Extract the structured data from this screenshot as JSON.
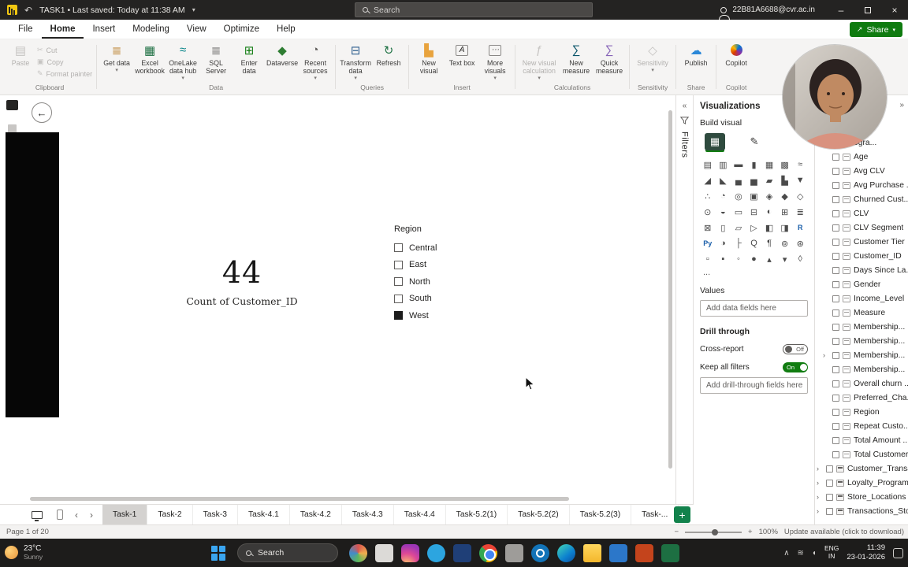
{
  "titlebar": {
    "document_title": "TASK1 • Last saved: Today at 11:38 AM",
    "search_placeholder": "Search",
    "account_email": "22B81A6688@cvr.ac.in"
  },
  "menubar": {
    "items": [
      "File",
      "Home",
      "Insert",
      "Modeling",
      "View",
      "Optimize",
      "Help"
    ],
    "share_label": "Share"
  },
  "ribbon": {
    "clipboard": {
      "label": "Clipboard",
      "paste": "Paste",
      "cut": "Cut",
      "copy": "Copy",
      "format_painter": "Format painter"
    },
    "data": {
      "label": "Data",
      "get_data": "Get data",
      "excel_workbook": "Excel workbook",
      "onelake": "OneLake data hub",
      "sql_server": "SQL Server",
      "enter_data": "Enter data",
      "dataverse": "Dataverse",
      "recent_sources": "Recent sources"
    },
    "queries": {
      "label": "Queries",
      "transform_data": "Transform data",
      "refresh": "Refresh"
    },
    "insert_group": {
      "label": "Insert",
      "new_visual": "New visual",
      "text_box": "Text box",
      "more_visuals": "More visuals"
    },
    "calculations": {
      "label": "Calculations",
      "new_visual_calculation": "New visual calculation",
      "new_measure": "New measure",
      "quick_measure": "Quick measure"
    },
    "sensitivity": {
      "label": "Sensitivity",
      "button": "Sensitivity"
    },
    "share": {
      "label": "Share",
      "publish": "Publish"
    },
    "copilot": {
      "label": "Copilot",
      "button": "Copilot"
    }
  },
  "canvas": {
    "card": {
      "value": "44",
      "label": "Count of Customer_ID"
    },
    "slicer": {
      "title": "Region",
      "options": [
        {
          "label": "Central",
          "checked": false
        },
        {
          "label": "East",
          "checked": false
        },
        {
          "label": "North",
          "checked": false
        },
        {
          "label": "South",
          "checked": false
        },
        {
          "label": "West",
          "checked": true
        }
      ]
    }
  },
  "filters_panel": {
    "label": "Filters"
  },
  "visualizations": {
    "title": "Visualizations",
    "build_visual_label": "Build visual",
    "more_icons_label": "...",
    "values_label": "Values",
    "values_placeholder": "Add data fields here",
    "drill_through_label": "Drill through",
    "cross_report_label": "Cross-report",
    "cross_report_state": "Off",
    "keep_all_filters_label": "Keep all filters",
    "keep_all_filters_state": "On",
    "drill_placeholder": "Add drill-through fields here",
    "accent_green": "#107c10",
    "icons": [
      {
        "name": "stacked-bar-chart",
        "glyph": "▤"
      },
      {
        "name": "stacked-column-chart",
        "glyph": "▥"
      },
      {
        "name": "clustered-bar-chart",
        "glyph": "▬"
      },
      {
        "name": "clustered-column-chart",
        "glyph": "▮"
      },
      {
        "name": "100-stacked-bar-chart",
        "glyph": "▦"
      },
      {
        "name": "100-stacked-column-chart",
        "glyph": "▩"
      },
      {
        "name": "line-chart",
        "glyph": "≈"
      },
      {
        "name": "area-chart",
        "glyph": "◢"
      },
      {
        "name": "stacked-area-chart",
        "glyph": "◣"
      },
      {
        "name": "line-and-stacked-column-chart",
        "glyph": "▄"
      },
      {
        "name": "line-and-clustered-column-chart",
        "glyph": "▅"
      },
      {
        "name": "ribbon-chart",
        "glyph": "▰"
      },
      {
        "name": "waterfall-chart",
        "glyph": "▙"
      },
      {
        "name": "funnel-chart",
        "glyph": "▼"
      },
      {
        "name": "scatter-chart",
        "glyph": "∴"
      },
      {
        "name": "pie-chart",
        "glyph": "◔"
      },
      {
        "name": "donut-chart",
        "glyph": "◎"
      },
      {
        "name": "treemap",
        "glyph": "▣"
      },
      {
        "name": "map",
        "glyph": "◈"
      },
      {
        "name": "filled-map",
        "glyph": "◆"
      },
      {
        "name": "shape-map",
        "glyph": "◇"
      },
      {
        "name": "azure-map",
        "glyph": "⊙"
      },
      {
        "name": "gauge",
        "glyph": "◒"
      },
      {
        "name": "card",
        "glyph": "▭"
      },
      {
        "name": "multi-row-card",
        "glyph": "⊟"
      },
      {
        "name": "kpi",
        "glyph": "◐"
      },
      {
        "name": "slicer",
        "glyph": "⊞"
      },
      {
        "name": "table",
        "glyph": "≣"
      },
      {
        "name": "matrix",
        "glyph": "⊠"
      },
      {
        "name": "paginated-report",
        "glyph": "▯"
      },
      {
        "name": "power-apps",
        "glyph": "▱"
      },
      {
        "name": "power-automate",
        "glyph": "▷"
      },
      {
        "name": "metrics",
        "glyph": "◧"
      },
      {
        "name": "scorecard",
        "glyph": "◨"
      },
      {
        "name": "r-script-visual",
        "glyph": "R"
      },
      {
        "name": "python-visual",
        "glyph": "Py"
      },
      {
        "name": "key-influencers",
        "glyph": "◑"
      },
      {
        "name": "decomposition-tree",
        "glyph": "├"
      },
      {
        "name": "qa-visual",
        "glyph": "Q"
      },
      {
        "name": "smart-narrative",
        "glyph": "¶"
      },
      {
        "name": "arcgis-map",
        "glyph": "⊚"
      },
      {
        "name": "power-bi-custom-visual",
        "glyph": "⊛"
      },
      {
        "name": "custom-visual-1",
        "glyph": "▫"
      },
      {
        "name": "custom-visual-2",
        "glyph": "▪"
      },
      {
        "name": "custom-visual-3",
        "glyph": "◦"
      },
      {
        "name": "custom-visual-4",
        "glyph": "●"
      },
      {
        "name": "custom-visual-5",
        "glyph": "▴"
      },
      {
        "name": "custom-visual-6",
        "glyph": "▾"
      },
      {
        "name": "custom-visual-7",
        "glyph": "◊"
      }
    ]
  },
  "fields": {
    "items": [
      {
        "label": "ogra...",
        "partial": true
      },
      {
        "label": "Age"
      },
      {
        "label": "Avg CLV"
      },
      {
        "label": "Avg Purchase ..."
      },
      {
        "label": "Churned Cust..."
      },
      {
        "label": "CLV"
      },
      {
        "label": "CLV Segment"
      },
      {
        "label": "Customer Tier"
      },
      {
        "label": "Customer_ID"
      },
      {
        "label": "Days Since La..."
      },
      {
        "label": "Gender"
      },
      {
        "label": "Income_Level"
      },
      {
        "label": "Measure"
      },
      {
        "label": "Membership..."
      },
      {
        "label": "Membership..."
      },
      {
        "label": "Membership...",
        "expander": true
      },
      {
        "label": "Membership..."
      },
      {
        "label": "Overall churn ..."
      },
      {
        "label": "Preferred_Cha..."
      },
      {
        "label": "Region"
      },
      {
        "label": "Repeat Custo..."
      },
      {
        "label": "Total Amount ..."
      },
      {
        "label": "Total Customers"
      },
      {
        "label": "Customer_Transactio...",
        "table": true
      },
      {
        "label": "Loyalty_Program",
        "table": true
      },
      {
        "label": "Store_Locations",
        "table": true
      },
      {
        "label": "Transactions_Store",
        "table": true
      }
    ]
  },
  "pagebar": {
    "tabs": [
      {
        "label": "Task-1",
        "active": true
      },
      {
        "label": "Task-2"
      },
      {
        "label": "Task-3"
      },
      {
        "label": "Task-4.1"
      },
      {
        "label": "Task-4.2"
      },
      {
        "label": "Task-4.3"
      },
      {
        "label": "Task-4.4"
      },
      {
        "label": "Task-5.2(1)"
      },
      {
        "label": "Task-5.2(2)"
      },
      {
        "label": "Task-5.2(3)"
      },
      {
        "label": "Task-..."
      }
    ],
    "new_page_label": "+"
  },
  "statusbar": {
    "page_indicator": "Page 1 of 20",
    "zoom_level": "100%",
    "update_text": "Update available (click to download)"
  },
  "taskbar": {
    "weather_temp": "23°C",
    "weather_condition": "Sunny",
    "search_label": "Search",
    "apps": [
      "colorful-app-icon",
      "light-app-icon",
      "instagram-icon",
      "telegram-icon",
      "blue-app-icon",
      "chrome-icon",
      "gray-app-icon",
      "compass-app-icon",
      "edge-icon",
      "file-explorer-icon",
      "vscode-icon",
      "powerpoint-icon",
      "excel-icon"
    ],
    "tray_icons": [
      "chevron-up-icon",
      "wifi-icon",
      "volume-icon"
    ],
    "tray": {
      "lang_top": "ENG",
      "lang_bottom": "IN",
      "time": "11:39",
      "date": "23-01-2026"
    }
  }
}
